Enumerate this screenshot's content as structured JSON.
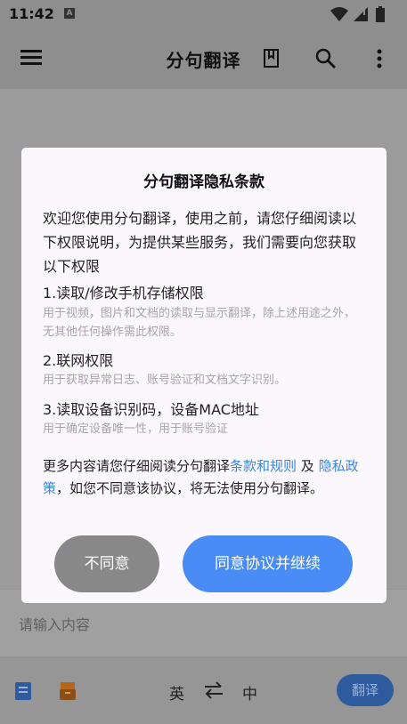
{
  "status_bar": {
    "time": "11:42",
    "badge": "A"
  },
  "app_bar": {
    "title": "分句翻译"
  },
  "input": {
    "placeholder": "请输入内容"
  },
  "bottom_bar": {
    "source_lang": "英",
    "target_lang": "中",
    "translate_label": "翻译"
  },
  "dialog": {
    "title": "分句翻译隐私条款",
    "intro": "欢迎您使用分句翻译，使用之前，请您仔细阅读以下权限说明，为提供某些服务，我们需要向您获取以下权限",
    "permissions": [
      {
        "title": "1.读取/修改手机存储权限",
        "desc": "用于视频，图片和文档的读取与显示翻译，除上述用途之外，无其他任何操作需此权限。"
      },
      {
        "title": "2.联网权限",
        "desc": "用于获取异常日志、账号验证和文档文字识别。"
      },
      {
        "title": "3.读取设备识别码，设备MAC地址",
        "desc": "用于确定设备唯一性，用于账号验证"
      }
    ],
    "more_prefix": "更多内容请您仔细阅读分句翻译",
    "terms_link": "条款和规则",
    "and_text": " 及 ",
    "privacy_link": "隐私政策",
    "more_suffix": "，如您不同意该协议，将无法使用分句翻译。",
    "decline_label": "不同意",
    "agree_label": "同意协议并继续"
  },
  "colors": {
    "accent": "#4a8cf5",
    "link": "#3b86e6",
    "decline": "#888888"
  }
}
